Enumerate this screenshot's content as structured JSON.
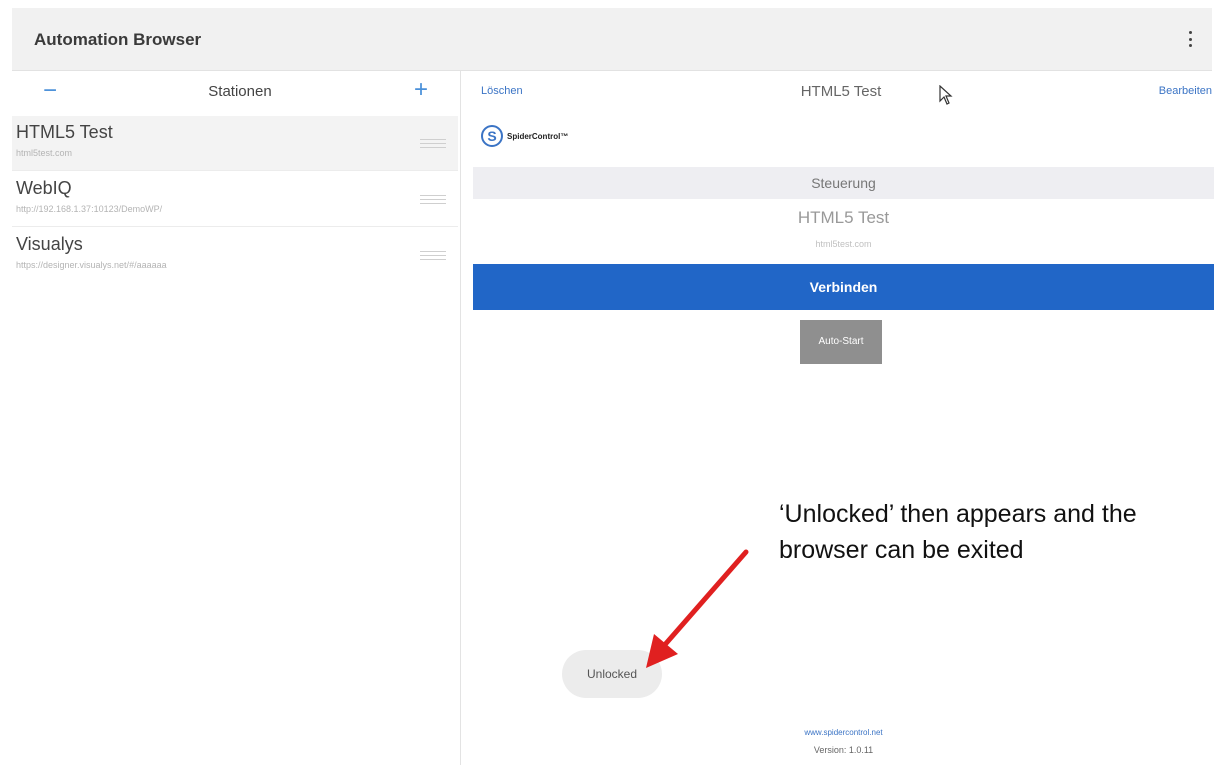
{
  "app": {
    "title": "Automation Browser"
  },
  "stations_panel": {
    "header": {
      "minus": "−",
      "title": "Stationen",
      "plus": "+"
    },
    "items": [
      {
        "name": "HTML5 Test",
        "url": "html5test.com"
      },
      {
        "name": "WebIQ",
        "url": "http://192.168.1.37:10123/DemoWP/"
      },
      {
        "name": "Visualys",
        "url": "https://designer.visualys.net/#/aaaaaa"
      }
    ]
  },
  "detail": {
    "delete_label": "Löschen",
    "title": "HTML5 Test",
    "edit_label": "Bearbeiten",
    "logo_letter": "S",
    "logo_text": "SpiderControl™",
    "section_label": "Steuerung",
    "station_title": "HTML5 Test",
    "station_url": "html5test.com",
    "connect_label": "Verbinden",
    "autostart_label": "Auto-Start",
    "footer_link": "www.spidercontrol.net",
    "version": "Version: 1.0.11"
  },
  "toast": {
    "text": "Unlocked"
  },
  "annotation": {
    "text": "‘Unlocked’ then appears and the browser can be exited"
  },
  "colors": {
    "accent": "#2166c7",
    "link": "#3b74c5",
    "arrow": "#e02020"
  }
}
